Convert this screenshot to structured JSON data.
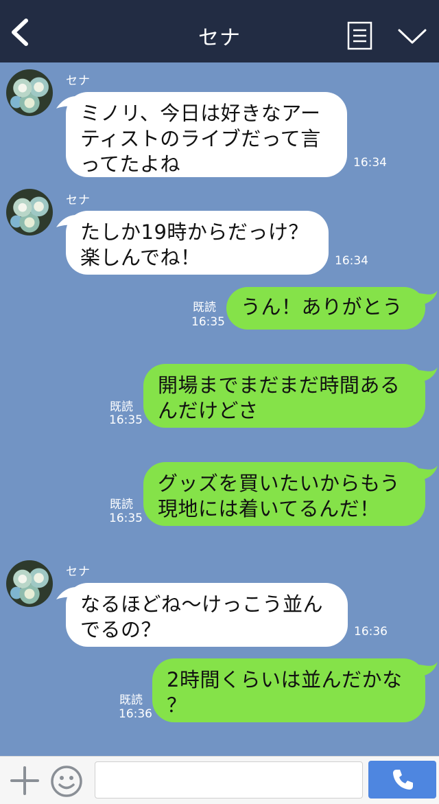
{
  "header": {
    "title": "セナ"
  },
  "contact": {
    "name": "セナ"
  },
  "messages": [
    {
      "side": "in",
      "text": "ミノリ、今日は好きなアー\nティストのライブだって言\nってたよね",
      "time": "16:34"
    },
    {
      "side": "in",
      "text": "たしか19時からだっけ？\n楽しんでね！",
      "time": "16:34"
    },
    {
      "side": "out",
      "text": "うん！ありがとう",
      "read": "既読",
      "time": "16:35"
    },
    {
      "side": "out",
      "text": "開場までまだまだ時間ある\nんだけどさ",
      "read": "既読",
      "time": "16:35"
    },
    {
      "side": "out",
      "text": "グッズを買いたいからもう\n現地には着いてるんだ！",
      "read": "既読",
      "time": "16:35"
    },
    {
      "side": "in",
      "text": "なるほどね〜けっこう並ん\nでるの？",
      "time": "16:36"
    },
    {
      "side": "out",
      "text": "2時間くらいは並んだかな\n？",
      "read": "既読",
      "time": "16:36"
    }
  ],
  "composer": {
    "value": "",
    "placeholder": ""
  },
  "colors": {
    "header_bg": "#222c43",
    "chat_bg": "#7294c4",
    "incoming_bubble": "#ffffff",
    "outgoing_bubble": "#85e249",
    "call_button": "#4e86e0"
  },
  "icons": {
    "back": "chevron-left-icon",
    "notes": "note-icon",
    "menu": "chevron-down-icon",
    "plus": "plus-icon",
    "emoji": "smiley-icon",
    "call": "phone-icon"
  }
}
